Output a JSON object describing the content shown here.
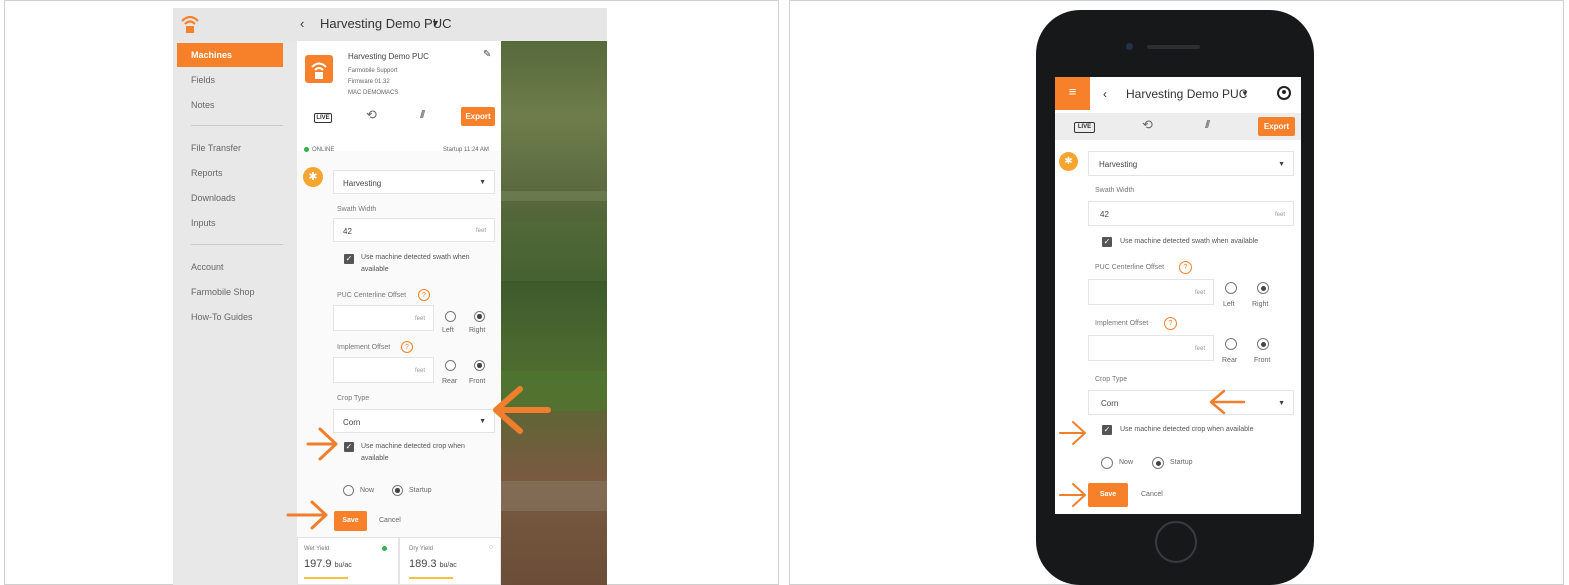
{
  "app": {
    "title": "Harvesting Demo PUC"
  },
  "sidebar": {
    "items": [
      {
        "label": "Machines",
        "active": true
      },
      {
        "label": "Fields"
      },
      {
        "label": "Notes"
      },
      {
        "label": "File Transfer"
      },
      {
        "label": "Reports"
      },
      {
        "label": "Downloads"
      },
      {
        "label": "Inputs"
      },
      {
        "label": "Account"
      },
      {
        "label": "Farmobile Shop"
      },
      {
        "label": "How-To Guides"
      }
    ]
  },
  "device": {
    "name": "Harvesting Demo PUC",
    "org": "Farmobile Support",
    "firmware": "Firmware 01.32",
    "mac": "MAC DEMOMACS"
  },
  "tabs": {
    "live": "LIVE",
    "export": "Export"
  },
  "status": {
    "online": "ONLINE",
    "startup": "Startup 11:24 AM"
  },
  "form": {
    "operation": "Harvesting",
    "swath_label": "Swath Width",
    "swath_value": "42",
    "unit": "feet",
    "swath_auto": "Use machine detected swath when available",
    "centerline_label": "PUC Centerline Offset",
    "help": "?",
    "left": "Left",
    "right": "Right",
    "implement_label": "Implement Offset",
    "rear": "Rear",
    "front": "Front",
    "crop_label": "Crop Type",
    "crop_value": "Corn",
    "crop_auto": "Use machine detected crop when available",
    "now": "Now",
    "startup": "Startup",
    "save": "Save",
    "cancel": "Cancel"
  },
  "desktop_wrap": {
    "swath_auto_1": "Use machine detected swath when",
    "swath_auto_2": "available",
    "crop_auto_1": "Use machine detected crop when",
    "crop_auto_2": "available"
  },
  "yield": {
    "wet": {
      "title": "Wet Yield",
      "value": "197.9",
      "unit": "bu/ac"
    },
    "dry": {
      "title": "Dry Yield",
      "value": "189.3",
      "unit": "bu/ac"
    }
  },
  "colors": {
    "accent": "#f7802b",
    "online": "#2fb24c"
  }
}
